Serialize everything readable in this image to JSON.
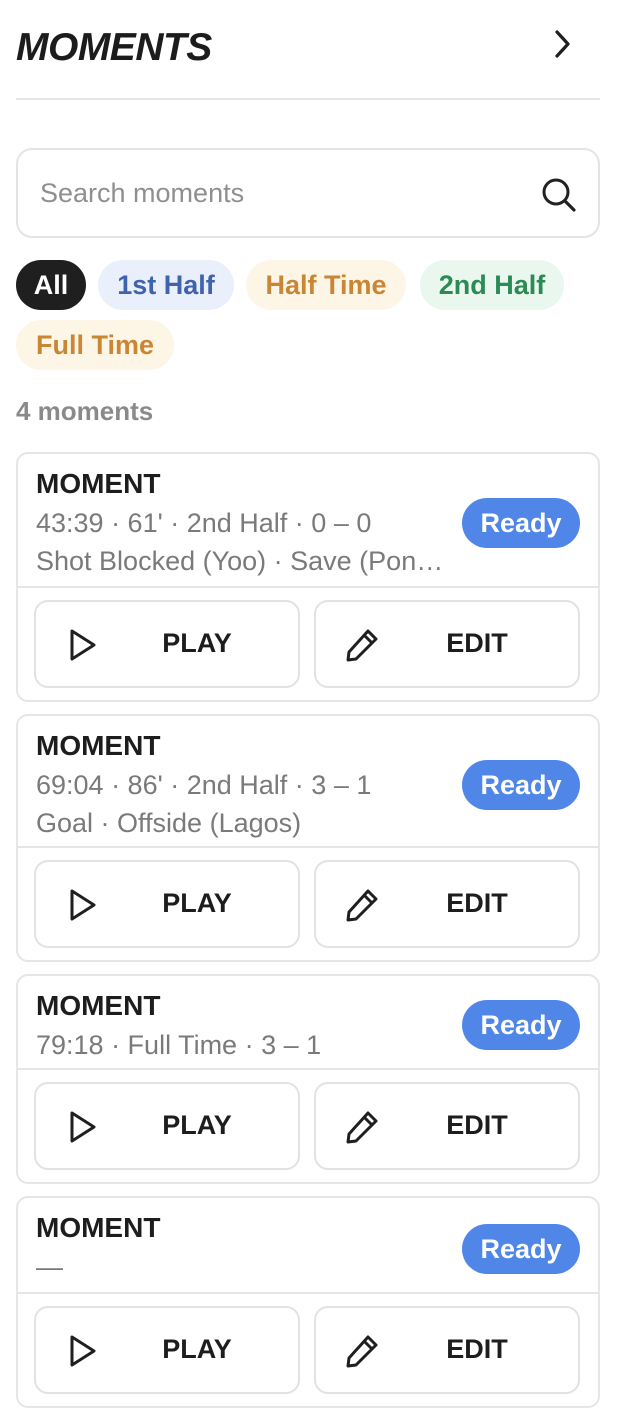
{
  "panel": {
    "title": "MOMENTS",
    "collapse_icon": "chevron-right-icon"
  },
  "search": {
    "placeholder": "Search moments",
    "value": "",
    "icon": "search-icon"
  },
  "filters": [
    {
      "label": "All",
      "active": true,
      "bg": "#1f1f1f",
      "fg": "#ffffff"
    },
    {
      "label": "1st Half",
      "active": false,
      "bg": "#eaf0fb",
      "fg": "#3f63ad"
    },
    {
      "label": "Half Time",
      "active": false,
      "bg": "#fdf5e6",
      "fg": "#c98634"
    },
    {
      "label": "2nd Half",
      "active": false,
      "bg": "#e9f7ef",
      "fg": "#2c8a55"
    },
    {
      "label": "Full Time",
      "active": false,
      "bg": "#fdf5e6",
      "fg": "#c98634"
    }
  ],
  "count_label": "4 moments",
  "moments": [
    {
      "title": "MOMENT",
      "meta": "43:39 · 61' · 2nd Half · 0 – 0",
      "events": "Shot Blocked (Yoo) · Save (Pon…",
      "status": "Ready",
      "play_label": "PLAY",
      "edit_label": "EDIT"
    },
    {
      "title": "MOMENT",
      "meta": "69:04 · 86' · 2nd Half · 3 – 1",
      "events": "Goal · Offside (Lagos)",
      "status": "Ready",
      "play_label": "PLAY",
      "edit_label": "EDIT"
    },
    {
      "title": "MOMENT",
      "meta": "79:18 · Full Time · 3 – 1",
      "events": "",
      "status": "Ready",
      "play_label": "PLAY",
      "edit_label": "EDIT"
    },
    {
      "title": "MOMENT",
      "meta": "—",
      "events": "",
      "status": "Ready",
      "play_label": "PLAY",
      "edit_label": "EDIT"
    }
  ],
  "colors": {
    "accent": "#4f86e8",
    "border": "#e6e6e6",
    "muted_text": "#7a7a7a"
  }
}
